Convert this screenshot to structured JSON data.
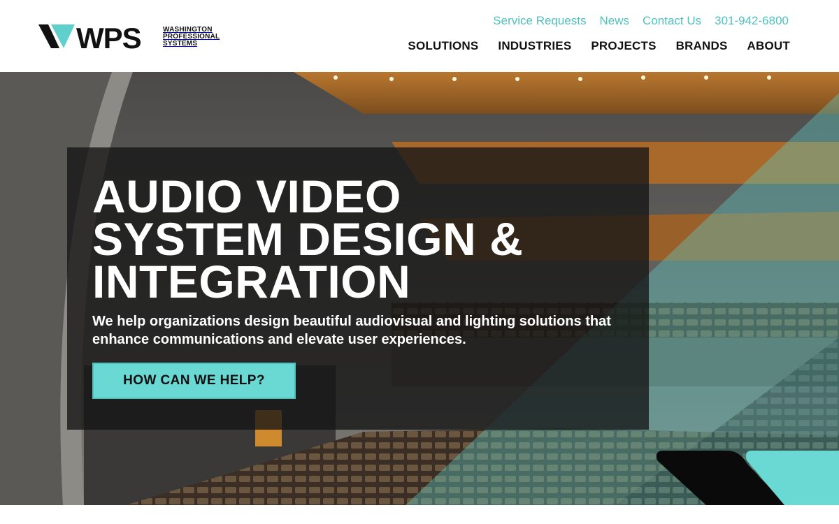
{
  "brand": {
    "name": "WPS",
    "line1": "WASHINGTON",
    "line2": "PROFESSIONAL",
    "line3": "SYSTEMS"
  },
  "utility_nav": [
    {
      "label": "Service Requests"
    },
    {
      "label": "News"
    },
    {
      "label": "Contact Us"
    },
    {
      "label": "301-942-6800"
    }
  ],
  "main_nav": [
    {
      "label": "SOLUTIONS"
    },
    {
      "label": "INDUSTRIES"
    },
    {
      "label": "PROJECTS"
    },
    {
      "label": "BRANDS"
    },
    {
      "label": "ABOUT"
    }
  ],
  "hero": {
    "title_line1": "AUDIO VIDEO",
    "title_line2": "SYSTEM DESIGN &",
    "title_line3": "INTEGRATION",
    "subtitle": "We help organizations design beautiful audiovisual and lighting solutions that enhance communications and elevate user experiences.",
    "cta_label": "HOW CAN WE HELP?"
  },
  "colors": {
    "accent_teal": "#4fc2bf",
    "cta_teal": "#6ad8d3",
    "panel_dark": "#141414",
    "text_dark": "#111111"
  }
}
